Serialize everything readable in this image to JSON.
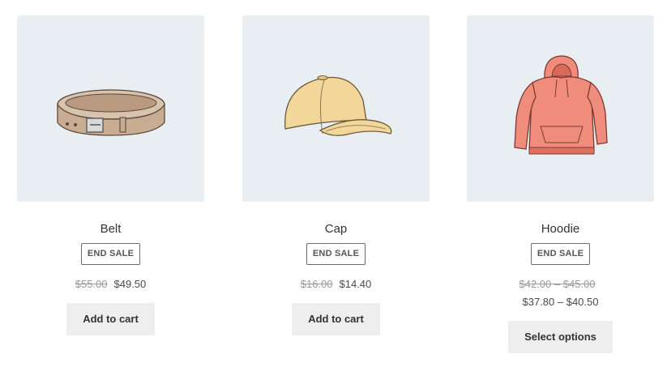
{
  "products": [
    {
      "title": "Belt",
      "badge": "END SALE",
      "regular_price": "$55.00",
      "sale_price": "$49.50",
      "button": "Add to cart",
      "image": "belt-illustration"
    },
    {
      "title": "Cap",
      "badge": "END SALE",
      "regular_price": "$16.00",
      "sale_price": "$14.40",
      "button": "Add to cart",
      "image": "cap-illustration"
    },
    {
      "title": "Hoodie",
      "badge": "END SALE",
      "regular_price": "$42.00 – $45.00",
      "sale_price": "$37.80 – $40.50",
      "button": "Select options",
      "image": "hoodie-illustration"
    }
  ],
  "colors": {
    "thumb_bg": "#e9eef3",
    "button_bg": "#eeeeee",
    "belt": "#c9ad93",
    "cap": "#f3d79a",
    "hoodie": "#f08c7c"
  }
}
